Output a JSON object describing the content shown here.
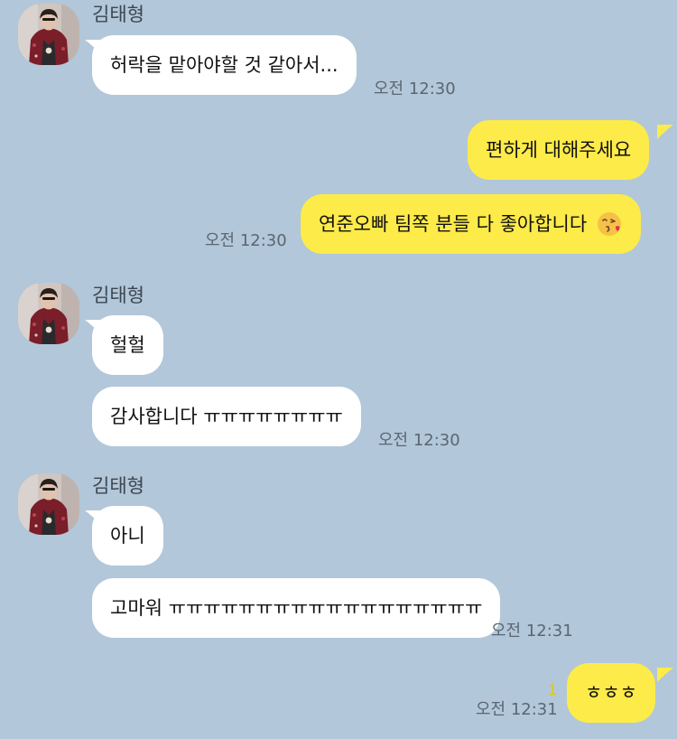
{
  "messages": [
    {
      "sender": "김태형",
      "text": "허락을 맡아야할 것 같아서...",
      "time": "오전 12:30"
    },
    {
      "text": "편하게 대해주세요"
    },
    {
      "text": "연준오빠 팀쪽 분들 다 좋아합니다",
      "emoji": "kissing-face-with-heart",
      "time": "오전 12:30"
    },
    {
      "sender": "김태형",
      "text": "헐헐"
    },
    {
      "text": "감사합니다 ㅠㅠㅠㅠㅠㅠㅠㅠ",
      "time": "오전 12:30"
    },
    {
      "sender": "김태형",
      "text": "아니"
    },
    {
      "text": "고마워 ㅠㅠㅠㅠㅠㅠㅠㅠㅠㅠㅠㅠㅠㅠㅠㅠㅠㅠ",
      "time": "오전 12:31"
    },
    {
      "text": "ㅎㅎㅎ",
      "unread": "1",
      "time": "오전 12:31"
    }
  ],
  "colors": {
    "background": "#b2c7d9",
    "incoming": "#ffffff",
    "outgoing": "#fdeb49",
    "unread": "#e6c800"
  }
}
